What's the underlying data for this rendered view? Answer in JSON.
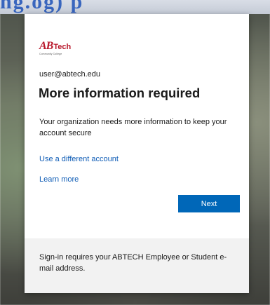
{
  "background": {
    "banner_text": "ng.og) p"
  },
  "logo": {
    "ab": "AB",
    "tech": "Tech",
    "subtitle": "Community College",
    "brand_color": "#b8172b"
  },
  "signin": {
    "email": "user@abtech.edu",
    "title": "More information required",
    "description": "Your organization needs more information to keep your account secure",
    "use_different_account": "Use a different account",
    "learn_more": "Learn more",
    "next_label": "Next",
    "accent_color": "#0067b8"
  },
  "footer": {
    "text": "Sign-in requires your ABTECH Employee or Student e-mail address."
  }
}
